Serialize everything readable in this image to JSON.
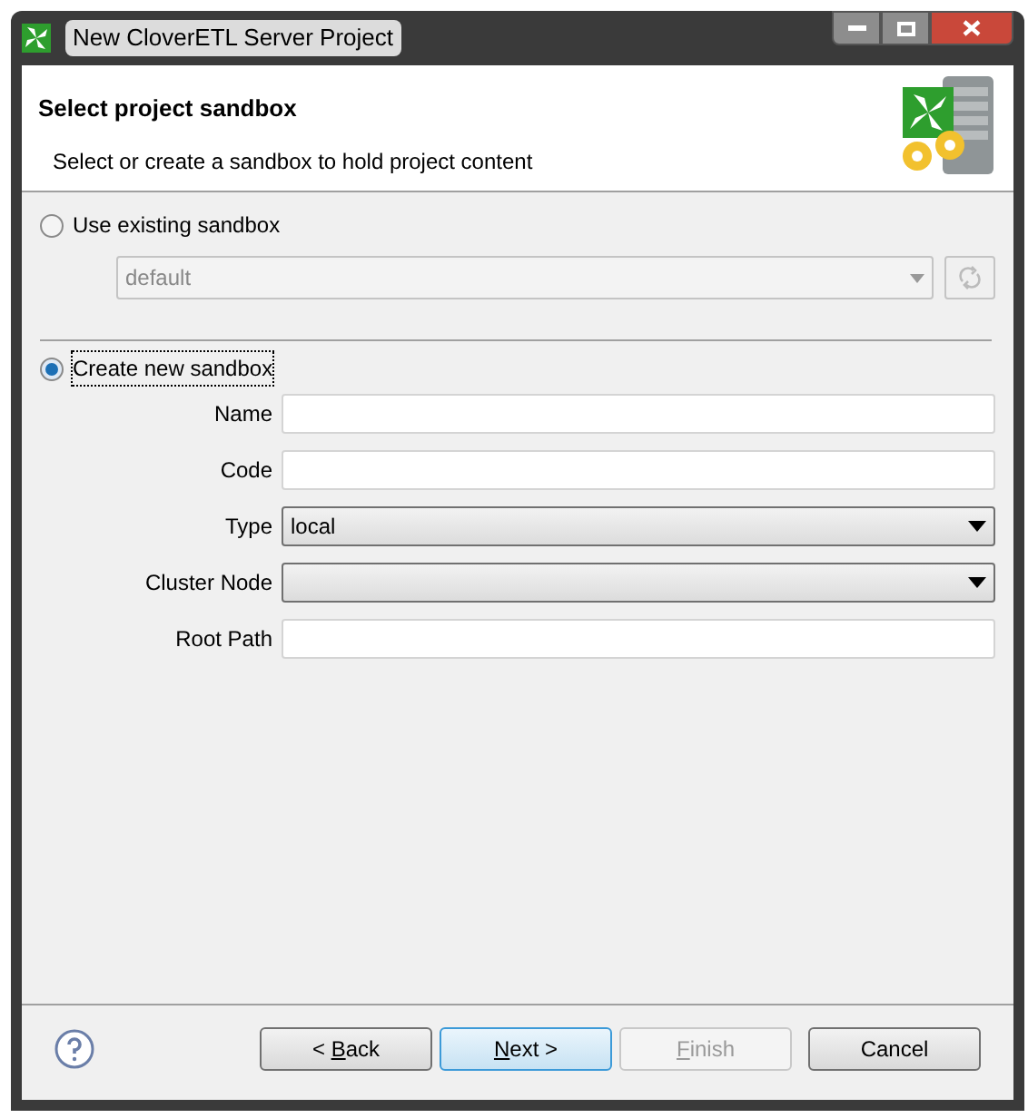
{
  "window": {
    "title": "New CloverETL Server Project"
  },
  "header": {
    "title": "Select project sandbox",
    "description": "Select or create a sandbox to hold project content"
  },
  "existing": {
    "label": "Use existing sandbox",
    "selected": false,
    "sandbox": {
      "value": "default",
      "disabled": true
    }
  },
  "create": {
    "label": "Create new sandbox",
    "selected": true,
    "focused": true
  },
  "fields": [
    {
      "label": "Name",
      "kind": "text"
    },
    {
      "label": "Code",
      "kind": "text"
    },
    {
      "label": "Type",
      "kind": "select",
      "value": "local"
    },
    {
      "label": "Cluster Node",
      "kind": "select"
    },
    {
      "label": "Root Path",
      "kind": "text"
    }
  ],
  "buttons": [
    {
      "before": "< ",
      "mnemonic": "B",
      "after": "ack",
      "disabled": false,
      "default": false
    },
    {
      "mnemonic": "N",
      "after": "ext >",
      "disabled": false,
      "default": true
    },
    {
      "mnemonic": "F",
      "after": "inish",
      "disabled": true,
      "default": false
    },
    {
      "before": "Cancel",
      "disabled": false,
      "default": false
    }
  ]
}
